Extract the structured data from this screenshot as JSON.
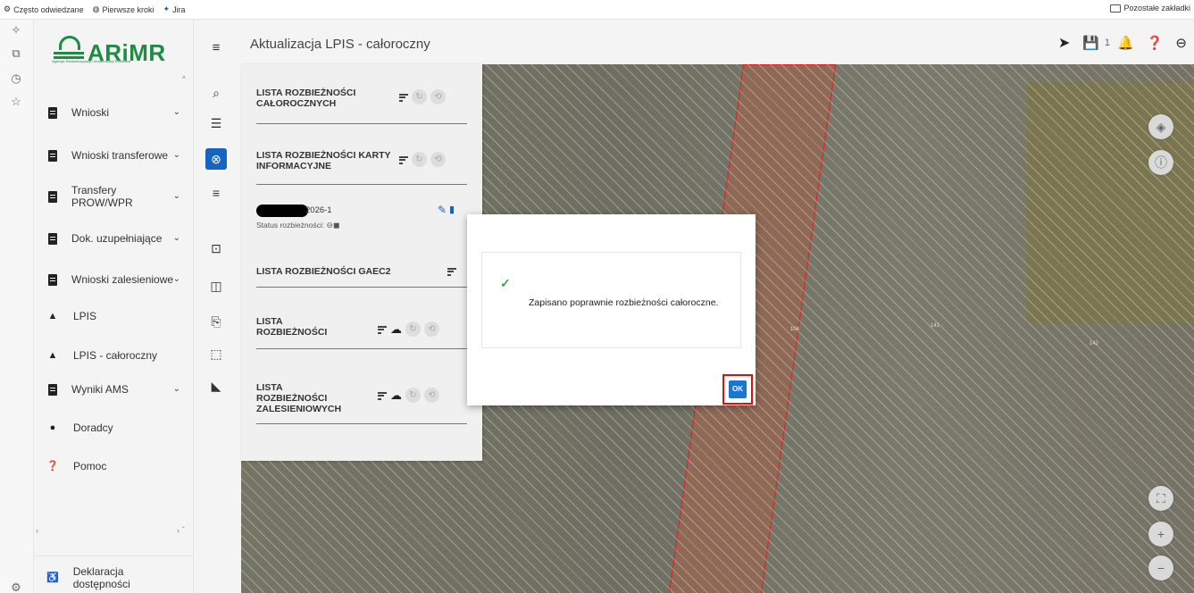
{
  "bookmarks": {
    "items": [
      "Często odwiedzane",
      "Pierwsze kroki",
      "Jira"
    ],
    "other": "Pozostałe zakładki"
  },
  "logo": {
    "name": "ARiMR",
    "subtitle": "Agencja Restrukturyzacji i Modernizacji Rolnictwa"
  },
  "menu": {
    "items": [
      {
        "label": "Wnioski",
        "icon": "document-icon"
      },
      {
        "label": "Wnioski transferowe",
        "icon": "document-icon"
      },
      {
        "label": "Transfery PROW/WPR",
        "icon": "document-icon"
      },
      {
        "label": "Dok. uzupełniające",
        "icon": "document-icon"
      },
      {
        "label": "Wnioski zalesieniowe",
        "icon": "document-icon"
      },
      {
        "label": "LPIS",
        "icon": "mountain-icon"
      },
      {
        "label": "LPIS - całoroczny",
        "icon": "mountain-icon"
      },
      {
        "label": "Wyniki AMS",
        "icon": "document-icon"
      },
      {
        "label": "Doradcy",
        "icon": "person-icon"
      },
      {
        "label": "Pomoc",
        "icon": "help-icon"
      }
    ],
    "footer": "Deklaracja dostępności"
  },
  "header": {
    "title": "Aktualizacja LPIS - całoroczny",
    "notification_count": "1"
  },
  "panel": {
    "list1": "LISTA ROZBIEŻNOŚCI CAŁOROCZNYCH",
    "list2": "LISTA ROZBIEŻNOŚCI KARTY INFORMACYJNE",
    "record_id": "2026-1",
    "status_label": "Status rozbieżności:",
    "list3": "LISTA ROZBIEŻNOŚCI GAEC2",
    "list4": "LISTA ROZBIEŻNOŚCI",
    "list5": "LISTA ROZBIEŻNOŚCI ZALESIENIOWYCH"
  },
  "map": {
    "labels": [
      "104",
      "141",
      "142"
    ]
  },
  "modal": {
    "message": "Zapisano poprawnie rozbieżności całoroczne.",
    "ok_label": "OK"
  }
}
